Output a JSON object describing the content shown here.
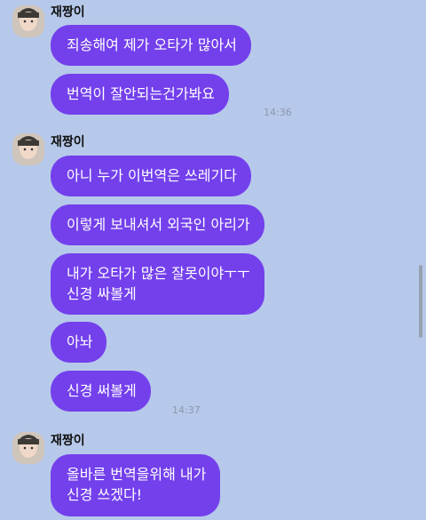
{
  "groups": [
    {
      "sender": "재짱이",
      "messages": [
        "죄송해여 제가 오타가 많아서",
        "번역이 잘안되는건가봐요"
      ],
      "time": "14:36"
    },
    {
      "sender": "재짱이",
      "messages": [
        "아니 누가 이번역은 쓰레기다",
        "이렇게 보내셔서 외국인 아리가",
        "내가 오타가 많은 잘못이야ㅜㅜ\n신경 싸볼게",
        "아놔",
        "신경 써볼게"
      ],
      "time": "14:37"
    },
    {
      "sender": "재짱이",
      "messages": [
        "올바른 번역을위해 내가\n신경 쓰겠다!"
      ],
      "time": ""
    }
  ],
  "colors": {
    "background": "#b7c9ea",
    "bubble": "#7340ec",
    "bubble_text": "#ffffff",
    "timestamp": "#8b97ab"
  },
  "icons": {
    "avatar": "profile-photo"
  }
}
